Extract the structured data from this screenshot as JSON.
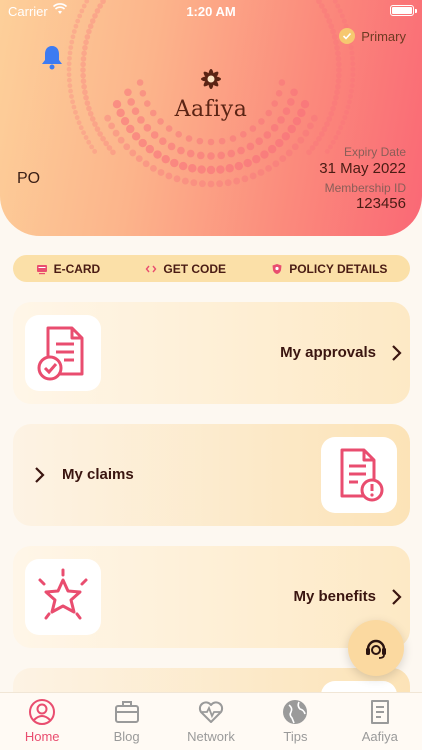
{
  "status_bar": {
    "carrier": "Carrier",
    "time": "1:20 AM"
  },
  "hero": {
    "badge": "Primary",
    "brand": "Aafiya",
    "initials": "PO",
    "expiry_label": "Expiry Date",
    "expiry_value": "31 May 2022",
    "membership_label": "Membership ID",
    "membership_value": "123456"
  },
  "actions": {
    "ecard": "E-CARD",
    "get_code": "GET CODE",
    "policy_details": "POLICY DETAILS"
  },
  "cards": {
    "approvals": "My approvals",
    "claims": "My claims",
    "benefits": "My benefits"
  },
  "tabs": [
    "Home",
    "Blog",
    "Network",
    "Tips",
    "Aafiya"
  ],
  "colors": {
    "accent": "#e94d6f",
    "dark": "#3a1510",
    "gold": "#fbe0a8"
  }
}
